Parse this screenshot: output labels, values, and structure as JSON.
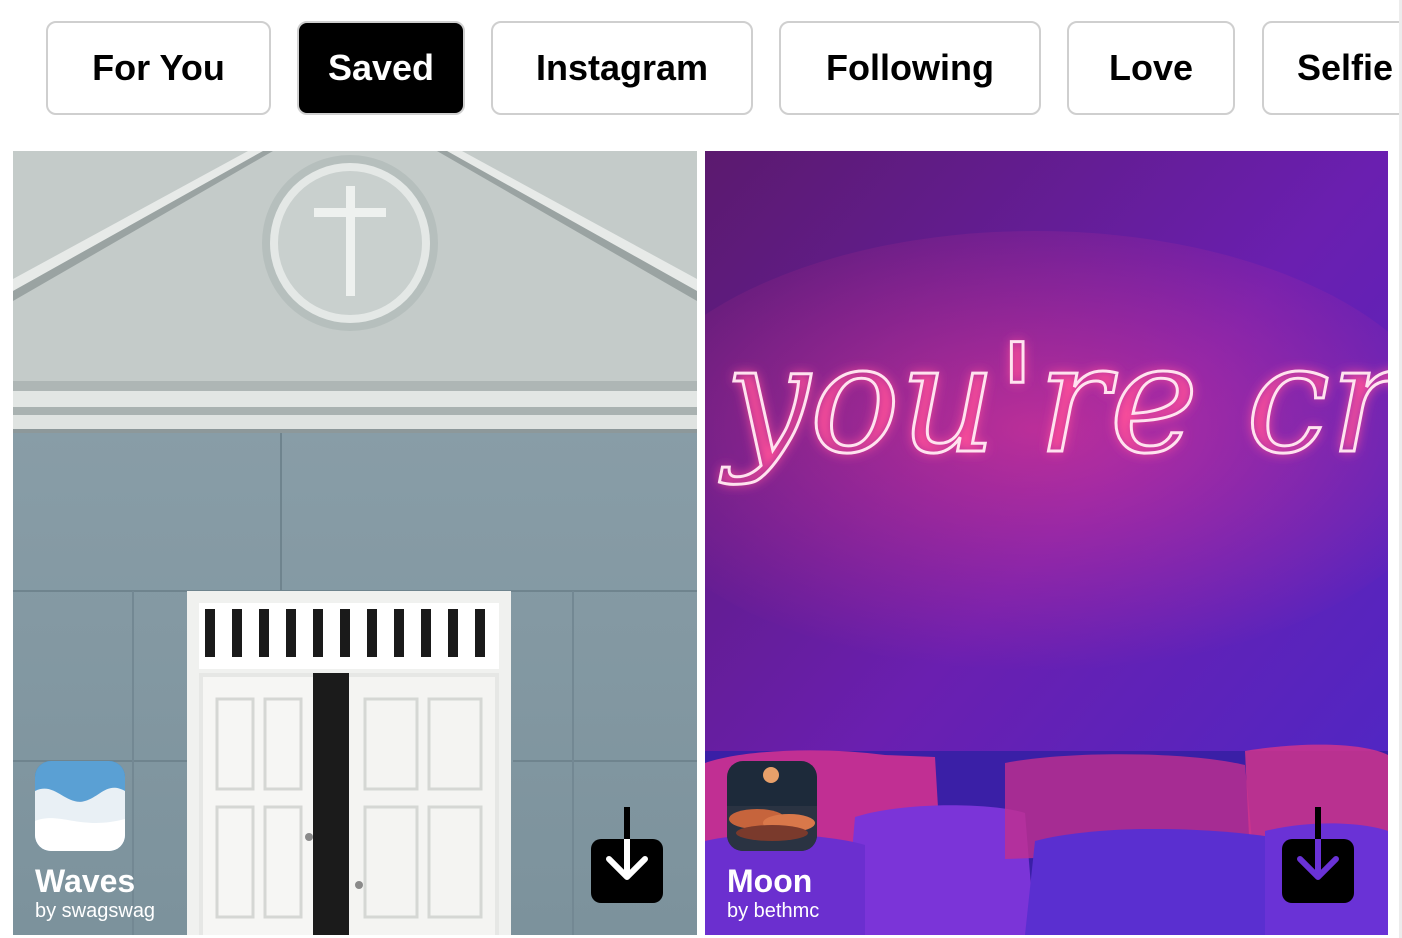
{
  "tabs": [
    {
      "label": "For You",
      "active": false
    },
    {
      "label": "Saved",
      "active": true
    },
    {
      "label": "Instagram",
      "active": false
    },
    {
      "label": "Following",
      "active": false
    },
    {
      "label": "Love",
      "active": false
    },
    {
      "label": "Selfie",
      "active": false
    }
  ],
  "cards": [
    {
      "title": "Waves",
      "author": "by swagswag",
      "icon": "waves-app-icon",
      "image": "church-facade-photo",
      "action_icon": "download-icon"
    },
    {
      "title": "Moon",
      "author": "by bethmc",
      "icon": "moon-app-icon",
      "image": "neon-sign-photo",
      "neon_text": "you're cra",
      "action_icon": "download-icon"
    }
  ],
  "colors": {
    "tab_border": "#cfcfcf",
    "tab_active_bg": "#000000",
    "neon_pink": "#ff4f9a",
    "wall_purple": "#5a1fb8"
  }
}
